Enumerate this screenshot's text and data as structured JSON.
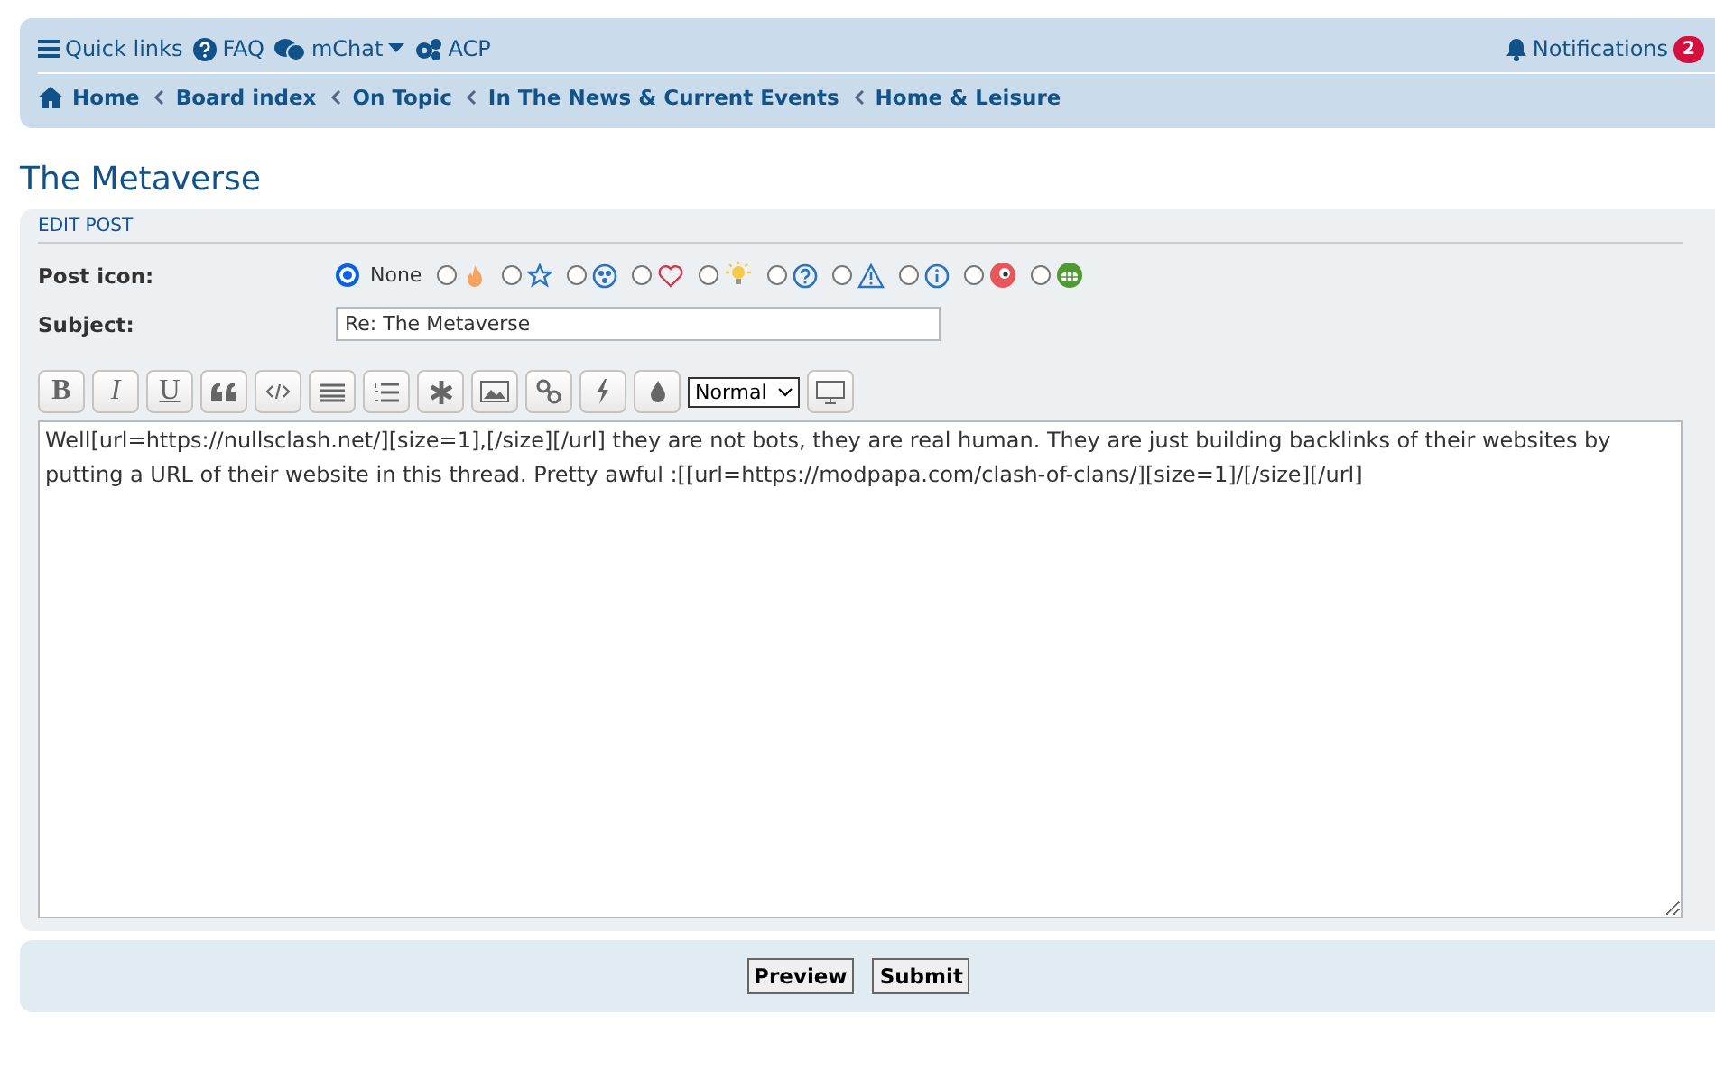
{
  "navbar": {
    "links": [
      {
        "label": "Quick links",
        "kind": "menu"
      },
      {
        "label": "FAQ",
        "kind": "help"
      },
      {
        "label": "mChat",
        "kind": "chat",
        "dropdown": true
      },
      {
        "label": "ACP",
        "kind": "gears"
      }
    ],
    "notifications": {
      "label": "Notifications",
      "count": "2"
    }
  },
  "breadcrumbs": [
    "Home",
    "Board index",
    "On Topic",
    "In The News & Current Events",
    "Home & Leisure"
  ],
  "page_title": "The Metaverse",
  "form": {
    "heading": "EDIT POST",
    "post_icon_label": "Post icon:",
    "post_icons": [
      {
        "kind": "none",
        "label": "None",
        "selected": true
      },
      {
        "kind": "fire",
        "selected": false
      },
      {
        "kind": "star",
        "selected": false
      },
      {
        "kind": "radiation",
        "selected": false
      },
      {
        "kind": "heart",
        "selected": false
      },
      {
        "kind": "bulb",
        "selected": false
      },
      {
        "kind": "question",
        "selected": false
      },
      {
        "kind": "warning",
        "selected": false
      },
      {
        "kind": "info",
        "selected": false
      },
      {
        "kind": "sad",
        "selected": false
      },
      {
        "kind": "grin",
        "selected": false
      }
    ],
    "subject_label": "Subject:",
    "subject": "Re: The Metaverse",
    "toolbar": [
      {
        "kind": "bold",
        "label": "B"
      },
      {
        "kind": "italic",
        "label": "I"
      },
      {
        "kind": "underline",
        "label": "U"
      },
      {
        "kind": "quote"
      },
      {
        "kind": "code"
      },
      {
        "kind": "list"
      },
      {
        "kind": "numlist"
      },
      {
        "kind": "asterisk"
      },
      {
        "kind": "image"
      },
      {
        "kind": "link"
      },
      {
        "kind": "flash"
      },
      {
        "kind": "drop"
      },
      {
        "kind": "select",
        "label": "Normal"
      },
      {
        "kind": "monitor"
      }
    ],
    "message": "Well[url=https://nullsclash.net/][size=1],[/size][/url] they are not bots, they are real human. They are just building backlinks of their websites by putting a URL of their website in this thread. Pretty awful :[[url=https://modpapa.com/clash-of-clans/][size=1]/[/size][/url]"
  },
  "buttons": [
    "Preview",
    "Submit"
  ]
}
